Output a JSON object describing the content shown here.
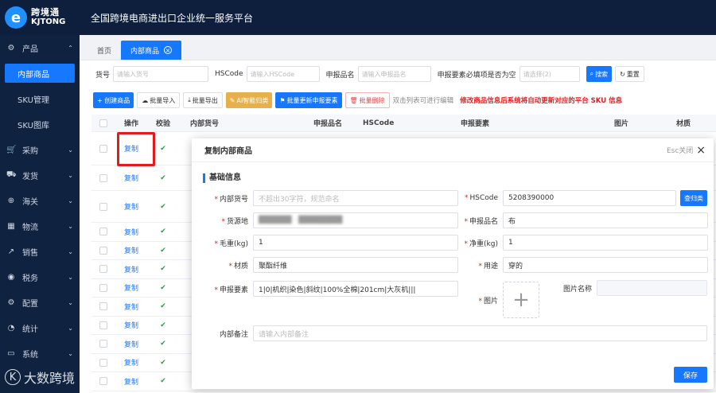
{
  "brand": {
    "logo_letter": "e",
    "name_cn": "跨境通",
    "name_en": "KJTONG",
    "platform_title": "全国跨境电商进出口企业统一服务平台"
  },
  "sidebar": {
    "items": [
      {
        "label": "产品",
        "icon": "box-icon",
        "glyph": "⚙",
        "expanded": true,
        "children": [
          {
            "label": "内部商品",
            "active": true
          },
          {
            "label": "SKU管理"
          },
          {
            "label": "SKU图库"
          }
        ]
      },
      {
        "label": "采购",
        "icon": "cart-icon",
        "glyph": "🛒"
      },
      {
        "label": "发货",
        "icon": "truck-icon",
        "glyph": "⛟"
      },
      {
        "label": "海关",
        "icon": "customs-icon",
        "glyph": "⊕"
      },
      {
        "label": "物流",
        "icon": "logistics-icon",
        "glyph": "▦"
      },
      {
        "label": "销售",
        "icon": "chart-icon",
        "glyph": "↗"
      },
      {
        "label": "税务",
        "icon": "tax-icon",
        "glyph": "◉"
      },
      {
        "label": "配置",
        "icon": "gear-icon",
        "glyph": "⚙"
      },
      {
        "label": "统计",
        "icon": "stats-icon",
        "glyph": "◔"
      },
      {
        "label": "系统",
        "icon": "monitor-icon",
        "glyph": "▭"
      }
    ],
    "watermark": "大数跨境"
  },
  "tabs": [
    {
      "label": "首页"
    },
    {
      "label": "内部商品",
      "active": true,
      "close": "⊗"
    }
  ],
  "filters": {
    "sku_label": "货号",
    "sku_placeholder": "请输入货号",
    "hscode_label": "HSCode",
    "hscode_placeholder": "请输入HSCode",
    "declare_name_label": "申报品名",
    "declare_name_placeholder": "请输入申报品名",
    "elements_required_label": "申报要素必填项是否为空",
    "elements_required_placeholder": "请选择(2)",
    "search_label": "搜索",
    "reset_label": "重置"
  },
  "toolbar": {
    "create": "+ 创建商品",
    "batch_import": "批量导入",
    "batch_export": "批量导出",
    "ai_classify": "AI智能归类",
    "batch_update": "批量更新申报要素",
    "batch_delete": "批量删除",
    "hint_edit": "双击列表可进行编辑",
    "hint_warning": "修改商品信息后系统将自动更新对应的平台 SKU 信息"
  },
  "table": {
    "columns": [
      {
        "label": "操作",
        "width": 40
      },
      {
        "label": "校验",
        "width": 40
      },
      {
        "label": "内部货号",
        "width": 155
      },
      {
        "label": "申报品名",
        "width": 62
      },
      {
        "label": "HSCode",
        "width": 123
      },
      {
        "label": "申报要素",
        "width": 193
      },
      {
        "label": "图片",
        "width": 78
      },
      {
        "label": "材质",
        "width": 40
      }
    ],
    "rows": [
      {
        "op": "复制",
        "check": "✔",
        "h": 42
      },
      {
        "op": "复制",
        "check": "✔",
        "h": 32
      },
      {
        "op": "复制",
        "check": "✔",
        "h": 40
      },
      {
        "op": "复制",
        "check": "✔"
      },
      {
        "op": "复制",
        "check": "✔"
      },
      {
        "op": "复制",
        "check": "✔"
      },
      {
        "op": "复制",
        "check": "✔"
      },
      {
        "op": "复制",
        "check": "✔"
      },
      {
        "op": "复制",
        "check": "✔"
      },
      {
        "op": "复制",
        "check": "✔"
      },
      {
        "op": "复制",
        "check": "✔"
      },
      {
        "op": "复制",
        "check": "✔"
      },
      {
        "op": "复制",
        "check": "✔"
      }
    ]
  },
  "modal": {
    "title": "复制内部商品",
    "close_hint": "Esc关闭",
    "section": "基础信息",
    "fields": {
      "internal_sku": {
        "label": "内部货号",
        "placeholder": "不超出30字符，规范命名"
      },
      "hscode": {
        "label": "HSCode",
        "value": "5208390000",
        "action": "查归类"
      },
      "origin": {
        "label": "货源地",
        "value": "██████ · ████████"
      },
      "declare_name": {
        "label": "申报品名",
        "value": "布"
      },
      "gross_weight": {
        "label": "毛重(kg)",
        "value": "1"
      },
      "net_weight": {
        "label": "净重(kg)",
        "value": "1"
      },
      "material": {
        "label": "材质",
        "value": "聚酯纤维"
      },
      "usage": {
        "label": "用途",
        "value": "穿的"
      },
      "elements": {
        "label": "申报要素",
        "value": "1|0|机织|染色|斜纹|100%全棉|201cm|大灰机|||"
      },
      "image": {
        "label": "图片",
        "upload": "+"
      },
      "image_name": {
        "label": "图片名称",
        "value": ""
      },
      "remark": {
        "label": "内部备注",
        "placeholder": "请输入内部备注"
      }
    },
    "save": "保存"
  }
}
